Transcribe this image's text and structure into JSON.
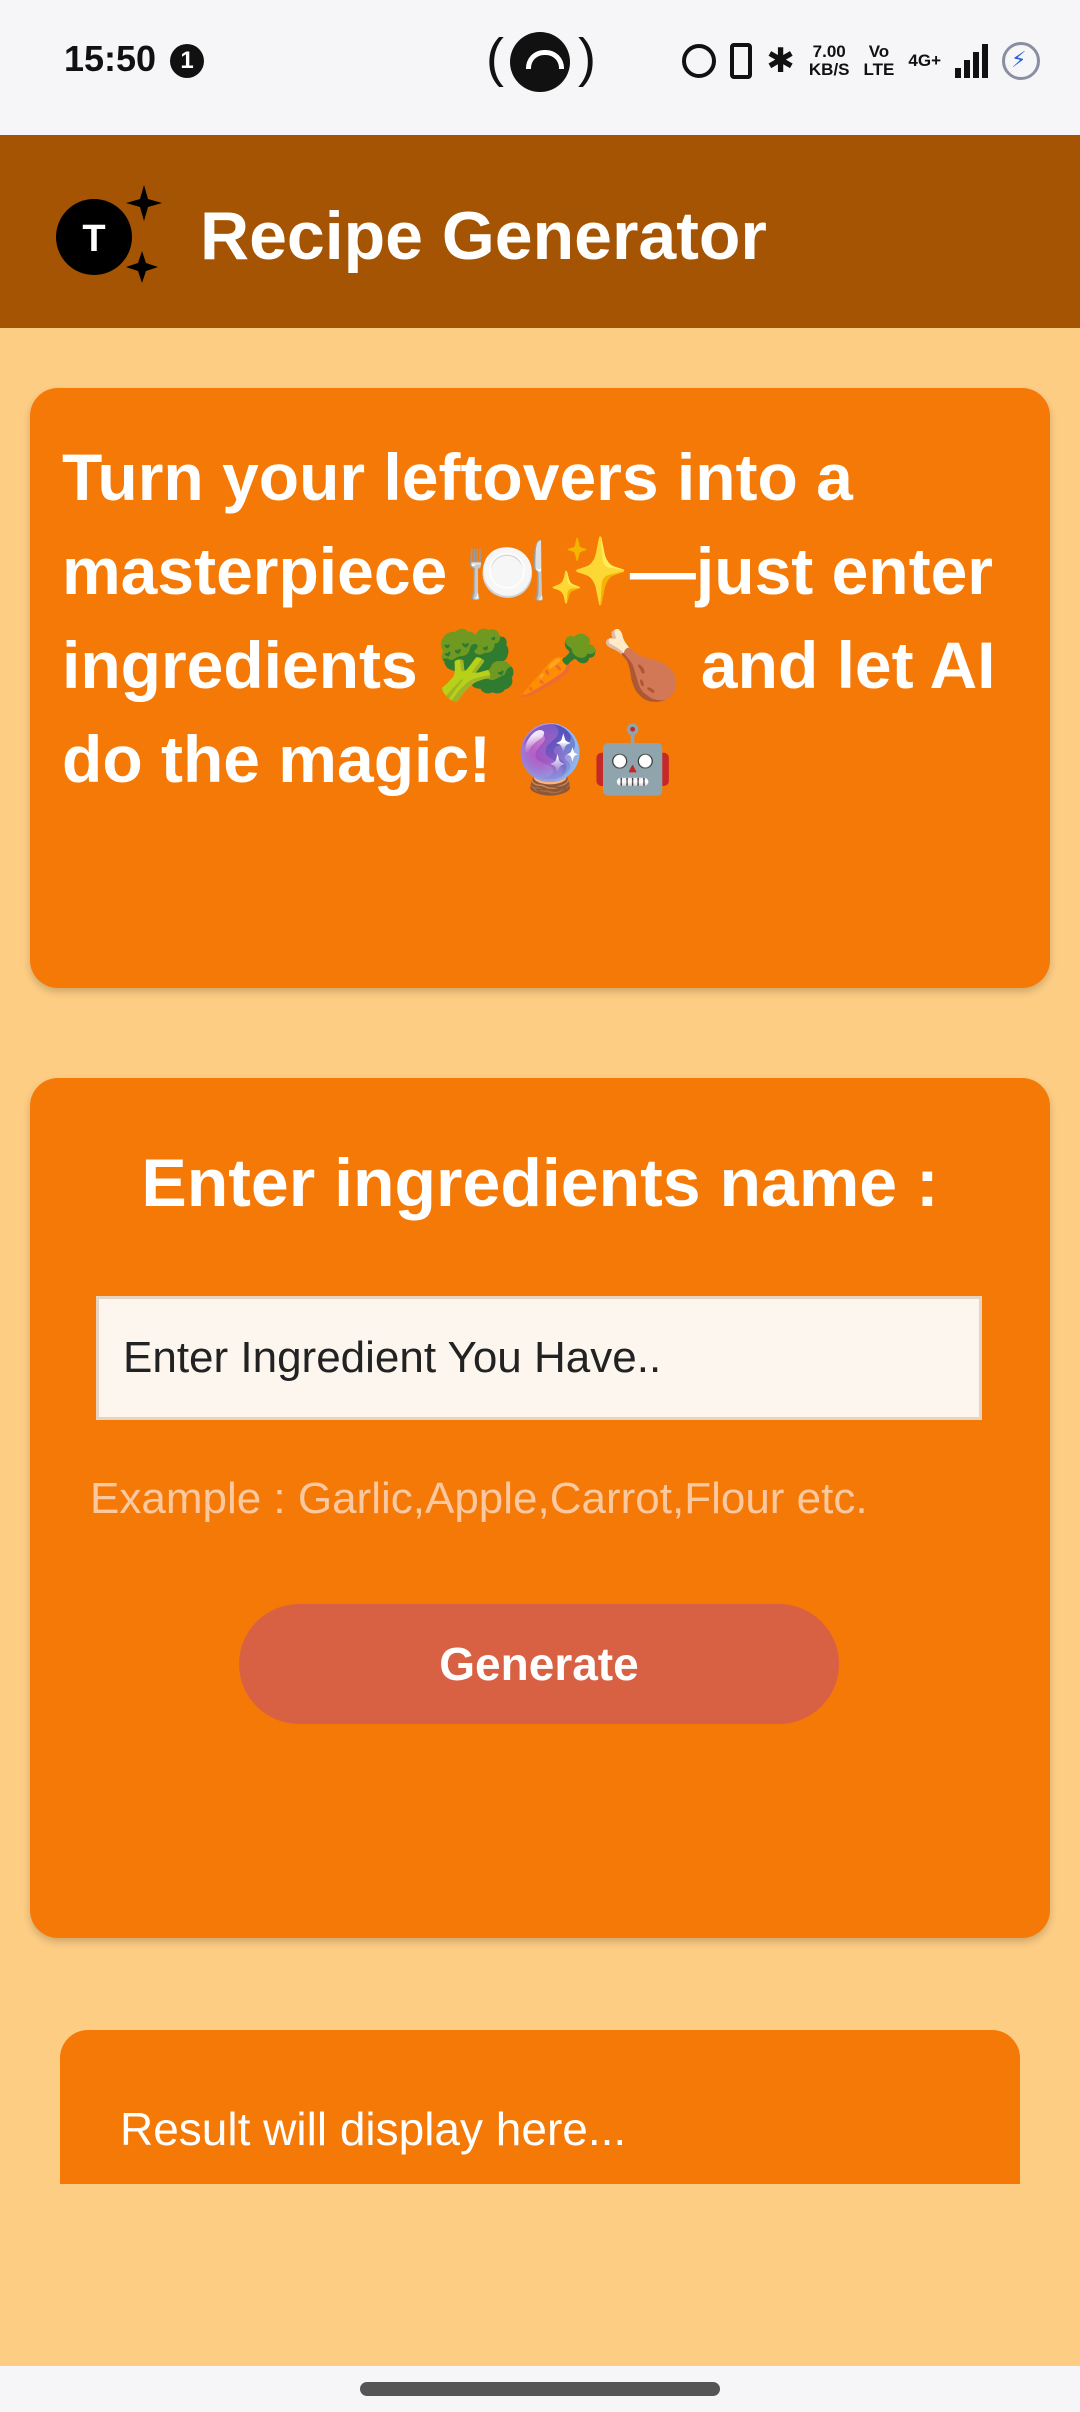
{
  "status_bar": {
    "time": "15:50",
    "notification_count": "1",
    "hotspot_left": "(",
    "hotspot_right": ")",
    "bluetooth_glyph": "✱",
    "speed_value": "7.00",
    "speed_unit": "KB/S",
    "volte_top": "Vo",
    "volte_bottom": "LTE",
    "network": "4G+",
    "icons": [
      "alarm-icon",
      "vibrate-icon",
      "bluetooth-icon",
      "speed-icon",
      "volte-icon",
      "signal-icon",
      "battery-charging-icon"
    ]
  },
  "app_bar": {
    "logo_letter": "T",
    "title": "Recipe Generator",
    "color": "#a45402"
  },
  "hero": {
    "text": "Turn your leftovers into a masterpiece 🍽️✨—just enter ingredients 🥦🥕🍗 and let AI do the magic! 🔮🤖"
  },
  "form": {
    "title": "Enter ingredients name :",
    "input_placeholder": "Enter Ingredient You Have..",
    "input_value": "",
    "example": "Example : Garlic,Apple,Carrot,Flour etc.",
    "generate_label": "Generate"
  },
  "result": {
    "text": "Result will display here..."
  },
  "colors": {
    "background": "#fdcd84",
    "card": "#f57906",
    "button": "#d96143",
    "header": "#a45402"
  }
}
